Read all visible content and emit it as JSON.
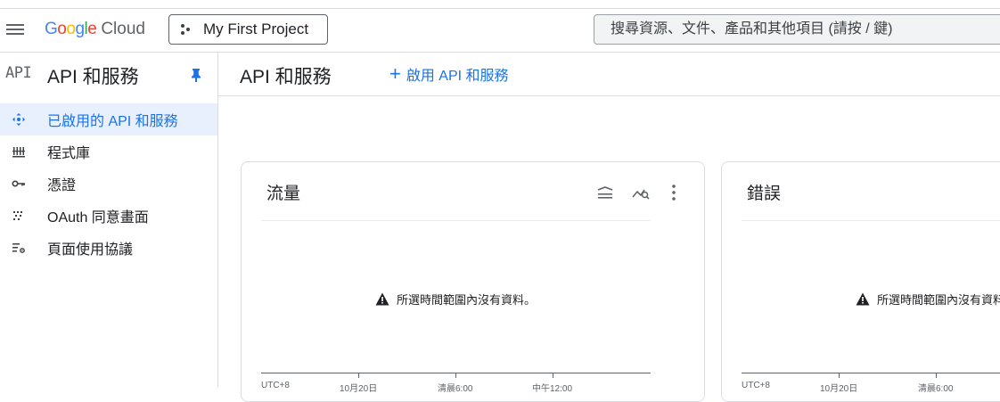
{
  "topbar": {
    "logo_google": "Google",
    "logo_cloud": "Cloud",
    "project_name": "My First Project",
    "search_placeholder": "搜尋資源、文件、產品和其他項目 (請按 / 鍵)"
  },
  "sidebar": {
    "icon_text": "API",
    "title": "API 和服務",
    "items": [
      {
        "label": "已啟用的 API 和服務",
        "icon": "diamond-arrows-icon",
        "active": true
      },
      {
        "label": "程式庫",
        "icon": "library-icon",
        "active": false
      },
      {
        "label": "憑證",
        "icon": "key-icon",
        "active": false
      },
      {
        "label": "OAuth 同意畫面",
        "icon": "dotted-consent-icon",
        "active": false
      },
      {
        "label": "頁面使用協議",
        "icon": "list-settings-icon",
        "active": false
      }
    ]
  },
  "main": {
    "title": "API 和服務",
    "enable_button": "啟用 API 和服務"
  },
  "cards": [
    {
      "title": "流量",
      "empty_message": "所選時間範圍內沒有資料。",
      "axis_labels": [
        "UTC+8",
        "10月20日",
        "清晨6:00",
        "中午12:00"
      ]
    },
    {
      "title": "錯誤",
      "empty_message": "所選時間範圍內沒有資料。",
      "axis_labels": [
        "UTC+8",
        "10月20日",
        "清晨6:00"
      ]
    }
  ],
  "colors": {
    "accent": "#1a73e8",
    "active_bg": "#e8f0fe",
    "border": "#dadce0"
  }
}
